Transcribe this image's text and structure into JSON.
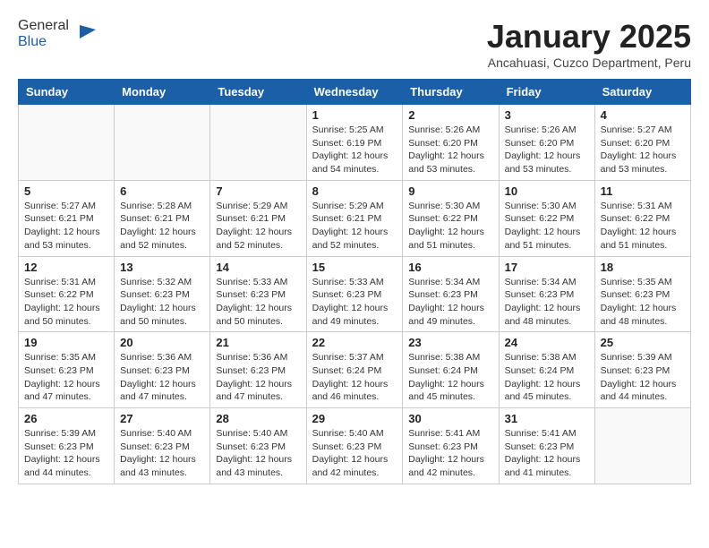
{
  "header": {
    "logo_general": "General",
    "logo_blue": "Blue",
    "title": "January 2025",
    "subtitle": "Ancahuasi, Cuzco Department, Peru"
  },
  "days_of_week": [
    "Sunday",
    "Monday",
    "Tuesday",
    "Wednesday",
    "Thursday",
    "Friday",
    "Saturday"
  ],
  "weeks": [
    [
      {
        "day": "",
        "info": ""
      },
      {
        "day": "",
        "info": ""
      },
      {
        "day": "",
        "info": ""
      },
      {
        "day": "1",
        "info": "Sunrise: 5:25 AM\nSunset: 6:19 PM\nDaylight: 12 hours\nand 54 minutes."
      },
      {
        "day": "2",
        "info": "Sunrise: 5:26 AM\nSunset: 6:20 PM\nDaylight: 12 hours\nand 53 minutes."
      },
      {
        "day": "3",
        "info": "Sunrise: 5:26 AM\nSunset: 6:20 PM\nDaylight: 12 hours\nand 53 minutes."
      },
      {
        "day": "4",
        "info": "Sunrise: 5:27 AM\nSunset: 6:20 PM\nDaylight: 12 hours\nand 53 minutes."
      }
    ],
    [
      {
        "day": "5",
        "info": "Sunrise: 5:27 AM\nSunset: 6:21 PM\nDaylight: 12 hours\nand 53 minutes."
      },
      {
        "day": "6",
        "info": "Sunrise: 5:28 AM\nSunset: 6:21 PM\nDaylight: 12 hours\nand 52 minutes."
      },
      {
        "day": "7",
        "info": "Sunrise: 5:29 AM\nSunset: 6:21 PM\nDaylight: 12 hours\nand 52 minutes."
      },
      {
        "day": "8",
        "info": "Sunrise: 5:29 AM\nSunset: 6:21 PM\nDaylight: 12 hours\nand 52 minutes."
      },
      {
        "day": "9",
        "info": "Sunrise: 5:30 AM\nSunset: 6:22 PM\nDaylight: 12 hours\nand 51 minutes."
      },
      {
        "day": "10",
        "info": "Sunrise: 5:30 AM\nSunset: 6:22 PM\nDaylight: 12 hours\nand 51 minutes."
      },
      {
        "day": "11",
        "info": "Sunrise: 5:31 AM\nSunset: 6:22 PM\nDaylight: 12 hours\nand 51 minutes."
      }
    ],
    [
      {
        "day": "12",
        "info": "Sunrise: 5:31 AM\nSunset: 6:22 PM\nDaylight: 12 hours\nand 50 minutes."
      },
      {
        "day": "13",
        "info": "Sunrise: 5:32 AM\nSunset: 6:23 PM\nDaylight: 12 hours\nand 50 minutes."
      },
      {
        "day": "14",
        "info": "Sunrise: 5:33 AM\nSunset: 6:23 PM\nDaylight: 12 hours\nand 50 minutes."
      },
      {
        "day": "15",
        "info": "Sunrise: 5:33 AM\nSunset: 6:23 PM\nDaylight: 12 hours\nand 49 minutes."
      },
      {
        "day": "16",
        "info": "Sunrise: 5:34 AM\nSunset: 6:23 PM\nDaylight: 12 hours\nand 49 minutes."
      },
      {
        "day": "17",
        "info": "Sunrise: 5:34 AM\nSunset: 6:23 PM\nDaylight: 12 hours\nand 48 minutes."
      },
      {
        "day": "18",
        "info": "Sunrise: 5:35 AM\nSunset: 6:23 PM\nDaylight: 12 hours\nand 48 minutes."
      }
    ],
    [
      {
        "day": "19",
        "info": "Sunrise: 5:35 AM\nSunset: 6:23 PM\nDaylight: 12 hours\nand 47 minutes."
      },
      {
        "day": "20",
        "info": "Sunrise: 5:36 AM\nSunset: 6:23 PM\nDaylight: 12 hours\nand 47 minutes."
      },
      {
        "day": "21",
        "info": "Sunrise: 5:36 AM\nSunset: 6:23 PM\nDaylight: 12 hours\nand 47 minutes."
      },
      {
        "day": "22",
        "info": "Sunrise: 5:37 AM\nSunset: 6:24 PM\nDaylight: 12 hours\nand 46 minutes."
      },
      {
        "day": "23",
        "info": "Sunrise: 5:38 AM\nSunset: 6:24 PM\nDaylight: 12 hours\nand 45 minutes."
      },
      {
        "day": "24",
        "info": "Sunrise: 5:38 AM\nSunset: 6:24 PM\nDaylight: 12 hours\nand 45 minutes."
      },
      {
        "day": "25",
        "info": "Sunrise: 5:39 AM\nSunset: 6:23 PM\nDaylight: 12 hours\nand 44 minutes."
      }
    ],
    [
      {
        "day": "26",
        "info": "Sunrise: 5:39 AM\nSunset: 6:23 PM\nDaylight: 12 hours\nand 44 minutes."
      },
      {
        "day": "27",
        "info": "Sunrise: 5:40 AM\nSunset: 6:23 PM\nDaylight: 12 hours\nand 43 minutes."
      },
      {
        "day": "28",
        "info": "Sunrise: 5:40 AM\nSunset: 6:23 PM\nDaylight: 12 hours\nand 43 minutes."
      },
      {
        "day": "29",
        "info": "Sunrise: 5:40 AM\nSunset: 6:23 PM\nDaylight: 12 hours\nand 42 minutes."
      },
      {
        "day": "30",
        "info": "Sunrise: 5:41 AM\nSunset: 6:23 PM\nDaylight: 12 hours\nand 42 minutes."
      },
      {
        "day": "31",
        "info": "Sunrise: 5:41 AM\nSunset: 6:23 PM\nDaylight: 12 hours\nand 41 minutes."
      },
      {
        "day": "",
        "info": ""
      }
    ]
  ]
}
